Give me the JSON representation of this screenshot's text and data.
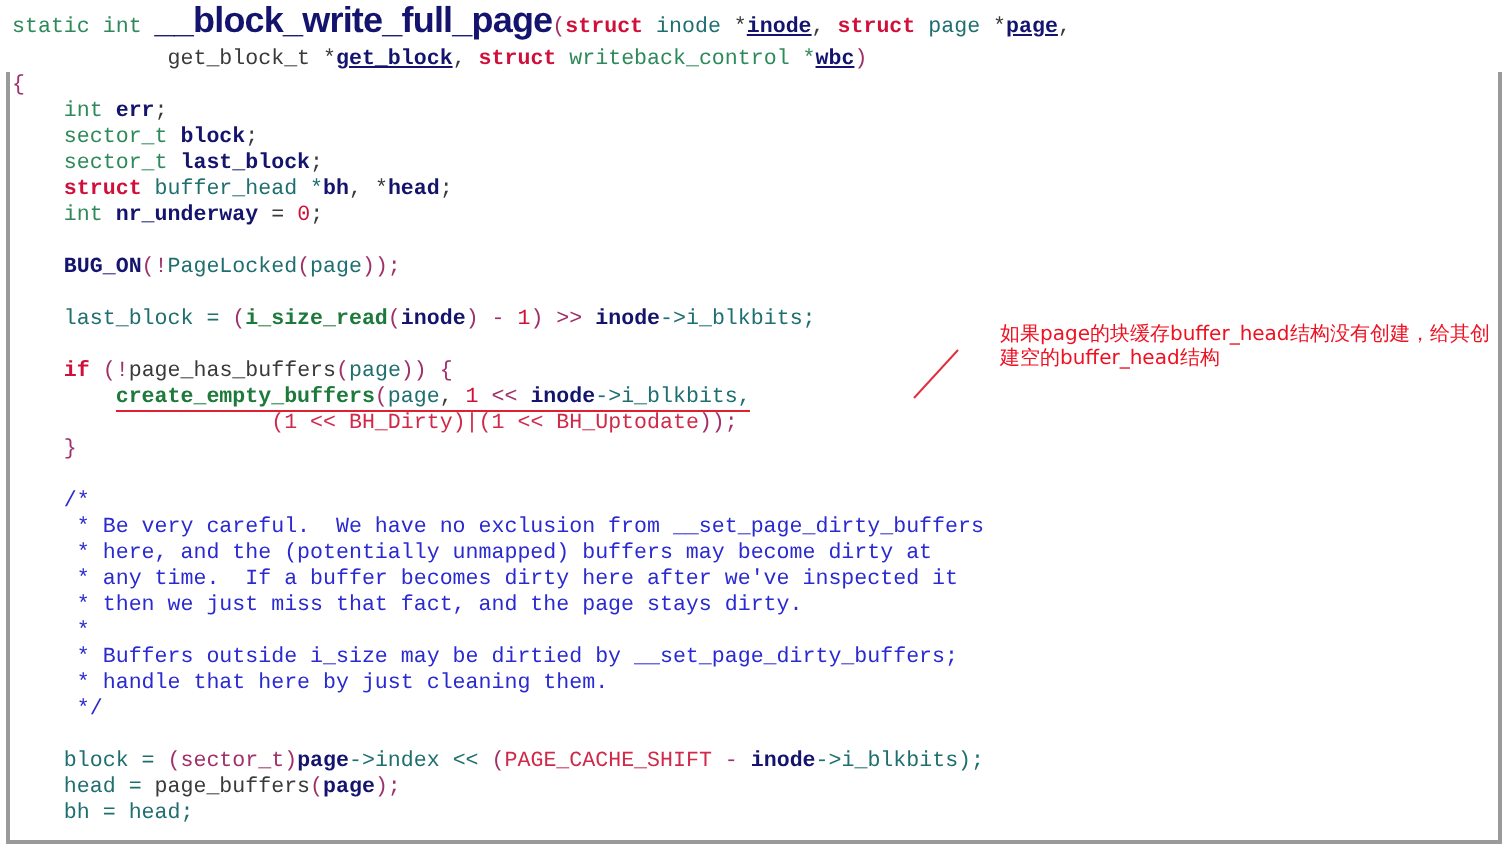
{
  "code_lines": [
    {
      "space_before": false,
      "underlined": false,
      "tokens": [
        {
          "text": "static int ",
          "kind": "type"
        },
        {
          "text": "__block_write_full_page",
          "kind": "title"
        },
        {
          "text": "(",
          "kind": "punct"
        },
        {
          "text": "struct",
          "kind": "kw"
        },
        {
          "text": " inode ",
          "kind": "member"
        },
        {
          "text": "*",
          "kind": "plain"
        },
        {
          "text": "inode",
          "kind": "param"
        },
        {
          "text": ", ",
          "kind": "plain"
        },
        {
          "text": "struct",
          "kind": "kw"
        },
        {
          "text": " page ",
          "kind": "member"
        },
        {
          "text": "*",
          "kind": "plain"
        },
        {
          "text": "page",
          "kind": "param"
        },
        {
          "text": ",",
          "kind": "plain"
        }
      ]
    },
    {
      "space_before": false,
      "underlined": false,
      "tokens": [
        {
          "text": "            get_block_t *",
          "kind": "plain"
        },
        {
          "text": "get_block",
          "kind": "param"
        },
        {
          "text": ", ",
          "kind": "plain"
        },
        {
          "text": "struct",
          "kind": "kw"
        },
        {
          "text": " writeback_control *",
          "kind": "type"
        },
        {
          "text": "wbc",
          "kind": "param"
        },
        {
          "text": ")",
          "kind": "punct"
        }
      ]
    },
    {
      "space_before": false,
      "underlined": false,
      "tokens": [
        {
          "text": "{",
          "kind": "punct"
        }
      ]
    },
    {
      "space_before": false,
      "underlined": false,
      "tokens": [
        {
          "text": "    int ",
          "kind": "type"
        },
        {
          "text": "err",
          "kind": "var"
        },
        {
          "text": ";",
          "kind": "plain"
        }
      ]
    },
    {
      "space_before": false,
      "underlined": false,
      "tokens": [
        {
          "text": "    sector_t ",
          "kind": "type"
        },
        {
          "text": "block",
          "kind": "var"
        },
        {
          "text": ";",
          "kind": "plain"
        }
      ]
    },
    {
      "space_before": false,
      "underlined": false,
      "tokens": [
        {
          "text": "    sector_t ",
          "kind": "type"
        },
        {
          "text": "last_block",
          "kind": "var"
        },
        {
          "text": ";",
          "kind": "plain"
        }
      ]
    },
    {
      "space_before": false,
      "underlined": false,
      "tokens": [
        {
          "text": "    struct",
          "kind": "kw"
        },
        {
          "text": " buffer_head *",
          "kind": "member"
        },
        {
          "text": "bh",
          "kind": "var"
        },
        {
          "text": ", *",
          "kind": "plain"
        },
        {
          "text": "head",
          "kind": "var"
        },
        {
          "text": ";",
          "kind": "plain"
        }
      ]
    },
    {
      "space_before": false,
      "underlined": false,
      "tokens": [
        {
          "text": "    int ",
          "kind": "type"
        },
        {
          "text": "nr_underway",
          "kind": "var"
        },
        {
          "text": " = ",
          "kind": "plain"
        },
        {
          "text": "0",
          "kind": "num"
        },
        {
          "text": ";",
          "kind": "plain"
        }
      ]
    },
    {
      "space_before": true,
      "underlined": false,
      "tokens": [
        {
          "text": "    BUG_ON",
          "kind": "var"
        },
        {
          "text": "(!",
          "kind": "punct"
        },
        {
          "text": "PageLocked",
          "kind": "member"
        },
        {
          "text": "(",
          "kind": "punct"
        },
        {
          "text": "page",
          "kind": "member"
        },
        {
          "text": "));",
          "kind": "punct"
        }
      ]
    },
    {
      "space_before": true,
      "underlined": false,
      "tokens": [
        {
          "text": "    last_block = ",
          "kind": "member"
        },
        {
          "text": "(",
          "kind": "punct"
        },
        {
          "text": "i_size_read",
          "kind": "call"
        },
        {
          "text": "(",
          "kind": "punct"
        },
        {
          "text": "inode",
          "kind": "var"
        },
        {
          "text": ") - ",
          "kind": "punct"
        },
        {
          "text": "1",
          "kind": "num"
        },
        {
          "text": ") >> ",
          "kind": "punct"
        },
        {
          "text": "inode",
          "kind": "var"
        },
        {
          "text": "->i_blkbits;",
          "kind": "member"
        }
      ]
    },
    {
      "space_before": true,
      "underlined": false,
      "tokens": [
        {
          "text": "    if",
          "kind": "kw"
        },
        {
          "text": " (!",
          "kind": "punct"
        },
        {
          "text": "page_has_buffers",
          "kind": "plain"
        },
        {
          "text": "(",
          "kind": "punct"
        },
        {
          "text": "page",
          "kind": "member"
        },
        {
          "text": ")) {",
          "kind": "punct"
        }
      ]
    },
    {
      "space_before": false,
      "underlined": true,
      "tokens": [
        {
          "text": "        create_empty_buffers",
          "kind": "call"
        },
        {
          "text": "(",
          "kind": "punct"
        },
        {
          "text": "page",
          "kind": "member"
        },
        {
          "text": ", ",
          "kind": "plain"
        },
        {
          "text": "1",
          "kind": "num"
        },
        {
          "text": " << ",
          "kind": "punct"
        },
        {
          "text": "inode",
          "kind": "var"
        },
        {
          "text": "->i_blkbits,",
          "kind": "member"
        }
      ]
    },
    {
      "space_before": false,
      "underlined": false,
      "tokens": [
        {
          "text": "                    (1 << ",
          "kind": "macro"
        },
        {
          "text": "BH_Dirty",
          "kind": "macro"
        },
        {
          "text": ")|(1 << ",
          "kind": "macro"
        },
        {
          "text": "BH_Uptodate",
          "kind": "macro"
        },
        {
          "text": "));",
          "kind": "punct"
        }
      ]
    },
    {
      "space_before": false,
      "underlined": false,
      "tokens": [
        {
          "text": "    }",
          "kind": "punct"
        }
      ]
    },
    {
      "space_before": true,
      "underlined": false,
      "tokens": [
        {
          "text": "    /*",
          "kind": "comment"
        }
      ]
    },
    {
      "space_before": false,
      "underlined": false,
      "tokens": [
        {
          "text": "     * Be very careful.  We have no exclusion from __set_page_dirty_buffers",
          "kind": "comment"
        }
      ]
    },
    {
      "space_before": false,
      "underlined": false,
      "tokens": [
        {
          "text": "     * here, and the (potentially unmapped) buffers may become dirty at",
          "kind": "comment"
        }
      ]
    },
    {
      "space_before": false,
      "underlined": false,
      "tokens": [
        {
          "text": "     * any time.  If a buffer becomes dirty here after we've inspected it",
          "kind": "comment"
        }
      ]
    },
    {
      "space_before": false,
      "underlined": false,
      "tokens": [
        {
          "text": "     * then we just miss that fact, and the page stays dirty.",
          "kind": "comment"
        }
      ]
    },
    {
      "space_before": false,
      "underlined": false,
      "tokens": [
        {
          "text": "     *",
          "kind": "comment"
        }
      ]
    },
    {
      "space_before": false,
      "underlined": false,
      "tokens": [
        {
          "text": "     * Buffers outside i_size may be dirtied by __set_page_dirty_buffers;",
          "kind": "comment"
        }
      ]
    },
    {
      "space_before": false,
      "underlined": false,
      "tokens": [
        {
          "text": "     * handle that here by just cleaning them.",
          "kind": "comment"
        }
      ]
    },
    {
      "space_before": false,
      "underlined": false,
      "tokens": [
        {
          "text": "     */",
          "kind": "comment"
        }
      ]
    },
    {
      "space_before": true,
      "underlined": false,
      "tokens": [
        {
          "text": "    block = ",
          "kind": "member"
        },
        {
          "text": "(sector_t)",
          "kind": "punct"
        },
        {
          "text": "page",
          "kind": "var"
        },
        {
          "text": "->index << ",
          "kind": "member"
        },
        {
          "text": "(",
          "kind": "punct"
        },
        {
          "text": "PAGE_CACHE_SHIFT",
          "kind": "macro"
        },
        {
          "text": " - ",
          "kind": "punct"
        },
        {
          "text": "inode",
          "kind": "var"
        },
        {
          "text": "->i_blkbits);",
          "kind": "member"
        }
      ]
    },
    {
      "space_before": false,
      "underlined": false,
      "tokens": [
        {
          "text": "    head = ",
          "kind": "member"
        },
        {
          "text": "page_buffers",
          "kind": "plain"
        },
        {
          "text": "(",
          "kind": "punct"
        },
        {
          "text": "page",
          "kind": "var"
        },
        {
          "text": ");",
          "kind": "punct"
        }
      ]
    },
    {
      "space_before": false,
      "underlined": false,
      "tokens": [
        {
          "text": "    bh = head;",
          "kind": "member"
        }
      ]
    }
  ],
  "annotation": {
    "text": "如果page的块缓存buffer_head结构没有创建，给其创建空的buffer_head结构"
  }
}
